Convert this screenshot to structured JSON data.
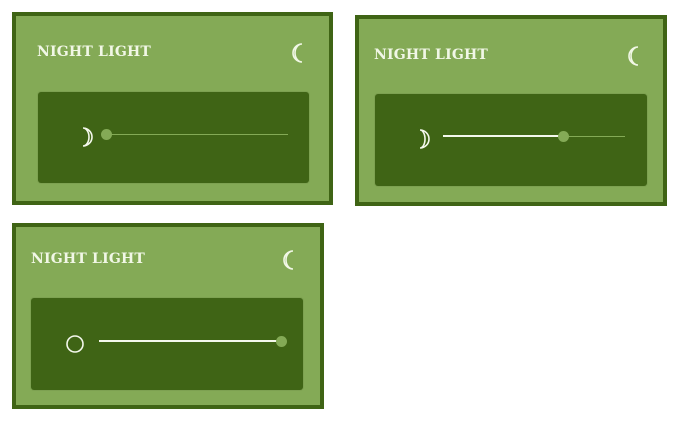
{
  "colors": {
    "card_bg": "#84aa56",
    "card_border": "#3f6415",
    "panel_bg": "#3f6415",
    "text": "#f1f7e6",
    "track": "#84aa56",
    "fill": "#f4f8ec",
    "thumb": "#84aa56"
  },
  "cards": [
    {
      "title": "NIGHT LIGHT",
      "header_icon": "crescent-moon-icon",
      "level_icon": "crescent-moon-icon",
      "brightness": 0.0
    },
    {
      "title": "NIGHT LIGHT",
      "header_icon": "crescent-moon-icon",
      "level_icon": "crescent-moon-icon",
      "brightness": 0.66
    },
    {
      "title": "NIGHT LIGHT",
      "header_icon": "crescent-moon-icon",
      "level_icon": "full-moon-icon",
      "brightness": 1.0
    }
  ]
}
